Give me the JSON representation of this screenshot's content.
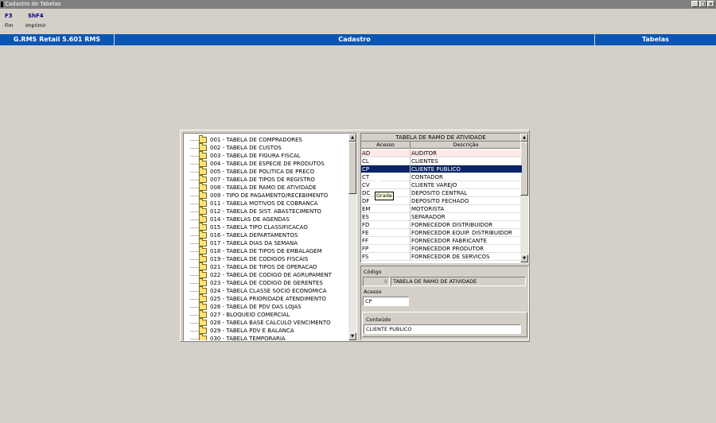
{
  "window": {
    "title": "Cadastro de Tabelas",
    "controls": [
      "_",
      "❐",
      "✕"
    ]
  },
  "toolbar": [
    {
      "key": "F3",
      "label": "Fim"
    },
    {
      "key": "ShF4",
      "label": "Imprimir"
    }
  ],
  "statusbar": {
    "app": "G.RMS Retail 5.601 RMS",
    "module": "Cadastro",
    "section": "Tabelas"
  },
  "tree": {
    "items": [
      "001 - TABELA DE COMPRADORES",
      "002 - TABELA DE CUSTOS",
      "003 - TABELA DE FIGURA FISCAL",
      "004 - TABELA DE ESPECIE DE PRODUTOS",
      "005 - TABELA DE POLITICA DE PRECO",
      "007 - TABELA DE TIPOS DE REGISTRO",
      "008 - TABELA DE RAMO DE ATIVIDADE",
      "009 - TIPO DE PAGAMENTO/RECEBIMENTO",
      "011 - TABELA MOTIVOS DE COBRANCA",
      "012 - TABELA DE SIST. ABASTECIMENTO",
      "014 - TABELAS DE AGENDAS",
      "015 - TABELA TIPO CLASSIFICACAO",
      "016 - TABELA DEPARTAMENTOS",
      "017 - TABELA DIAS DA SEMANA",
      "018 - TABELA DE TIPOS DE EMBALAGEM",
      "019 - TABELA DE CODIGOS FISCAIS",
      "021 - TABELA DE TIPOS DE OPERACAO",
      "022 - TABELA DE CODIGO DE AGRUPAMENT",
      "023 - TABELA DE CODIGO DE GERENTES",
      "024 - TABELA CLASSE SOCIO ECONOMICA",
      "025 - TABELA PRIORIDADE ATENDIMENTO",
      "026 - TABELA DE PDV DAS LOJAS",
      "027 - BLOQUEIO COMERCIAL",
      "028 - TABELA BASE CALCULO VENCIMENTO",
      "029 - TABELA PDV E BALANCA",
      "030 - TABELA TEMPORARIA"
    ]
  },
  "grid": {
    "title": "TABELA DE RAMO DE ATIVIDADE",
    "columns": [
      "Acesso",
      "Descrição"
    ],
    "selected_index": 2,
    "highlight_index": 0,
    "rows": [
      {
        "code": "AD",
        "desc": "AUDITOR"
      },
      {
        "code": "CL",
        "desc": "CLIENTES"
      },
      {
        "code": "CP",
        "desc": "CLIENTE PUBLICO"
      },
      {
        "code": "CT",
        "desc": "CONTADOR"
      },
      {
        "code": "CV",
        "desc": "CLIENTE VAREJO"
      },
      {
        "code": "DC",
        "desc": "DEPOSITO CENTRAL"
      },
      {
        "code": "DF",
        "desc": "DEPOSITO FECHADO"
      },
      {
        "code": "EM",
        "desc": "MOTORISTA"
      },
      {
        "code": "ES",
        "desc": "SEPARADOR"
      },
      {
        "code": "FD",
        "desc": "FORNECEDOR DISTRIBUIDOR"
      },
      {
        "code": "FE",
        "desc": "FORNECEDOR EQUIP. DISTRIBUIDOR"
      },
      {
        "code": "FF",
        "desc": "FORNECEDOR FABRICANTE"
      },
      {
        "code": "FP",
        "desc": "FORNECEDOR PRODUTOR"
      },
      {
        "code": "FS",
        "desc": "FORNECEDOR DE SERVICOS"
      }
    ],
    "tooltip": "Grade"
  },
  "form": {
    "codigo_label": "Código",
    "codigo_value": "8",
    "codigo_desc": "TABELA DE RAMO DE ATIVIDADE",
    "acesso_label": "Acesso",
    "acesso_value": "CP",
    "conteudo_label": "Conteúdo",
    "conteudo_value": "CLIENTE PUBLICO"
  }
}
